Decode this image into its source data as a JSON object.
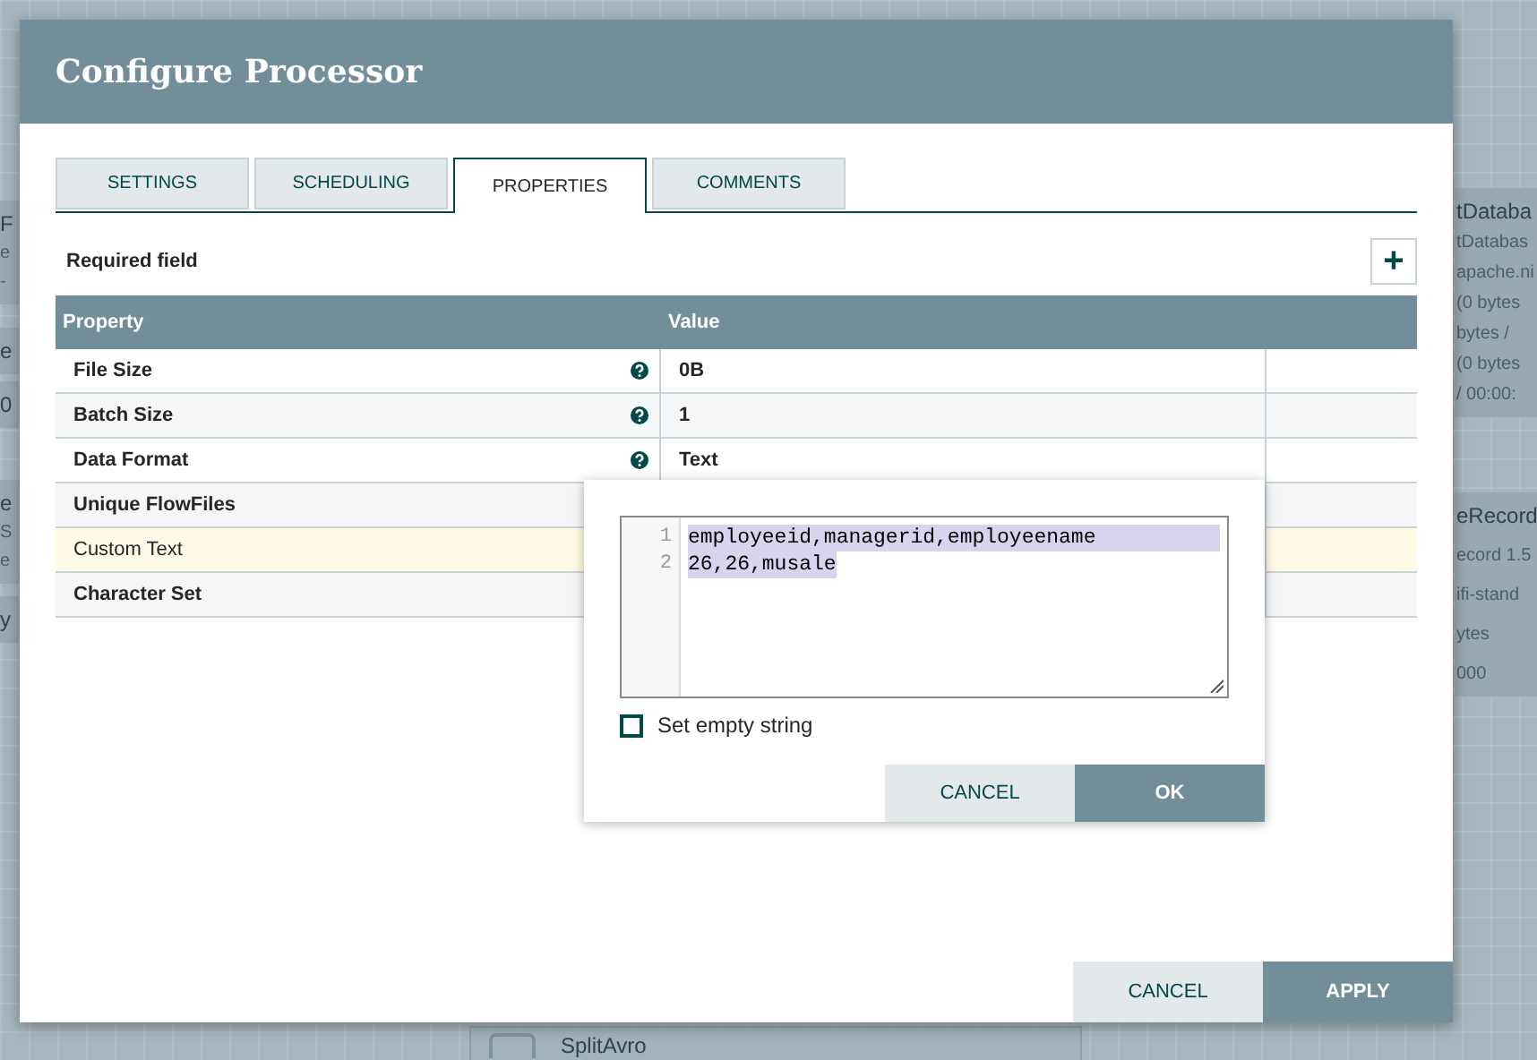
{
  "canvas": {
    "left_cards": [
      [
        "F",
        "e",
        "-"
      ],
      [
        "e"
      ],
      [
        "0"
      ],
      [
        "e",
        "S",
        "e"
      ],
      [
        "y"
      ]
    ],
    "right_cards": [
      [
        "tDataba",
        "tDatabas",
        "apache.ni",
        "(0 bytes",
        "bytes /",
        "(0 bytes",
        "/ 00:00:"
      ],
      [
        "eRecord",
        "ecord 1.5",
        "ifi-stand",
        "ytes",
        "000"
      ]
    ],
    "bottom_card": {
      "title": "SplitAvro"
    }
  },
  "dialog": {
    "title": "Configure Processor",
    "tabs": [
      {
        "label": "SETTINGS",
        "selected": false
      },
      {
        "label": "SCHEDULING",
        "selected": false
      },
      {
        "label": "PROPERTIES",
        "selected": true
      },
      {
        "label": "COMMENTS",
        "selected": false
      }
    ],
    "required_note": "Required field",
    "add_button": "+",
    "table": {
      "columns": [
        "Property",
        "Value"
      ],
      "rows": [
        {
          "property": "File Size",
          "value": "0B",
          "required": true,
          "help": true,
          "selected": false
        },
        {
          "property": "Batch Size",
          "value": "1",
          "required": true,
          "help": true,
          "selected": false
        },
        {
          "property": "Data Format",
          "value": "Text",
          "required": true,
          "help": true,
          "selected": false
        },
        {
          "property": "Unique FlowFiles",
          "required": true,
          "help": false,
          "selected": false
        },
        {
          "property": "Custom Text",
          "required": false,
          "help": false,
          "selected": true
        },
        {
          "property": "Character Set",
          "required": true,
          "help": false,
          "selected": false
        }
      ]
    },
    "editor": {
      "lines": [
        {
          "number": "1",
          "text": "employeeid,managerid,employeename"
        },
        {
          "number": "2",
          "text": "26,26,musale"
        }
      ],
      "empty_string": {
        "label": "Set empty string",
        "checked": false
      },
      "buttons": [
        {
          "label": "CANCEL",
          "kind": "secondary"
        },
        {
          "label": "OK",
          "kind": "primary"
        }
      ]
    },
    "buttons": [
      {
        "label": "CANCEL",
        "kind": "secondary"
      },
      {
        "label": "APPLY",
        "kind": "primary"
      }
    ]
  }
}
